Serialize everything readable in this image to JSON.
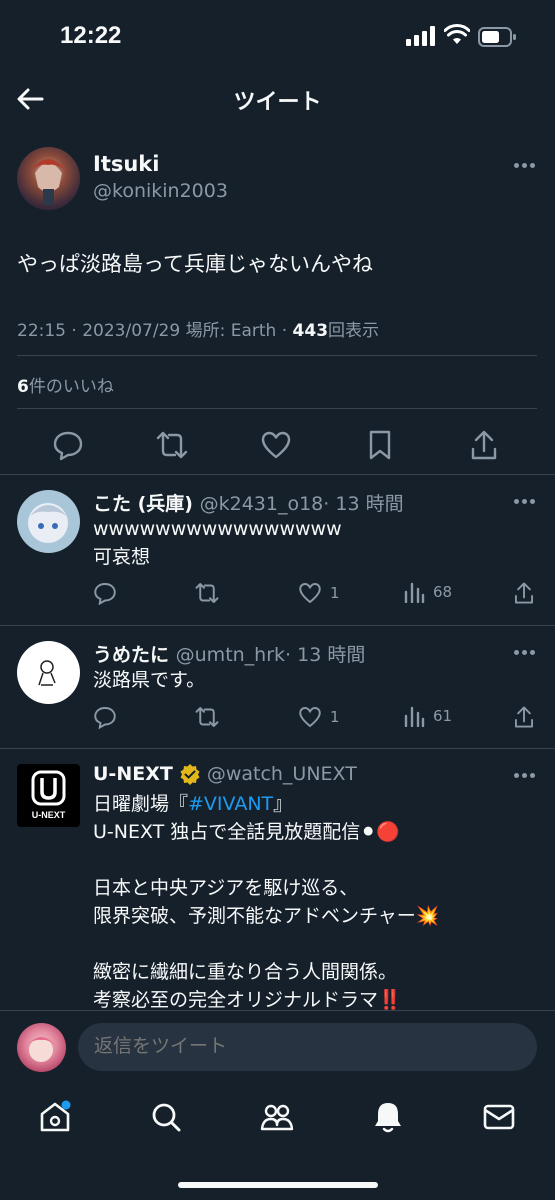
{
  "status": {
    "time": "12:22"
  },
  "header": {
    "title": "ツイート"
  },
  "main_tweet": {
    "name": "Itsuki",
    "handle": "@konikin2003",
    "text": "やっぱ淡路島って兵庫じゃないんやね",
    "time": "22:15 · 2023/07/29",
    "location_label": "場所: Earth ·",
    "views_count": "443",
    "views_label": "回表示",
    "likes_count": "6",
    "likes_label": "件のいいね"
  },
  "replies": [
    {
      "name": "こた (兵庫)",
      "handle": "@k2431_o18",
      "time": "· 13 時間",
      "line1": "wwwwwwwwwwwwwwww",
      "line2": "可哀想",
      "likes": "1",
      "views": "68"
    },
    {
      "name": "うめたに",
      "handle": "@umtn_hrk",
      "time": "· 13 時間",
      "line1": "淡路県です。",
      "likes": "1",
      "views": "61"
    },
    {
      "name": "U-NEXT",
      "handle": "@watch_UNEXT",
      "logo_text": "U-NEXT",
      "line1_prefix": "日曜劇場『",
      "hashtag": "#VIVANT",
      "line1_suffix": "』",
      "line2": "U-NEXT 独占で全話見放題配信⚫🔴",
      "line3": "日本と中央アジアを駆け巡る、",
      "line4": "限界突破、予測不能なアドベンチャー💥",
      "line5": "緻密に繊細に重なり合う人間関係。",
      "line6": "考察必至の完全オリジナルドラマ‼️"
    }
  ],
  "reply_bar": {
    "placeholder": "返信をツイート"
  },
  "colors": {
    "background": "#15202b",
    "accent": "#1d9bf0",
    "muted": "#8b98a5",
    "divider": "#38444d"
  }
}
